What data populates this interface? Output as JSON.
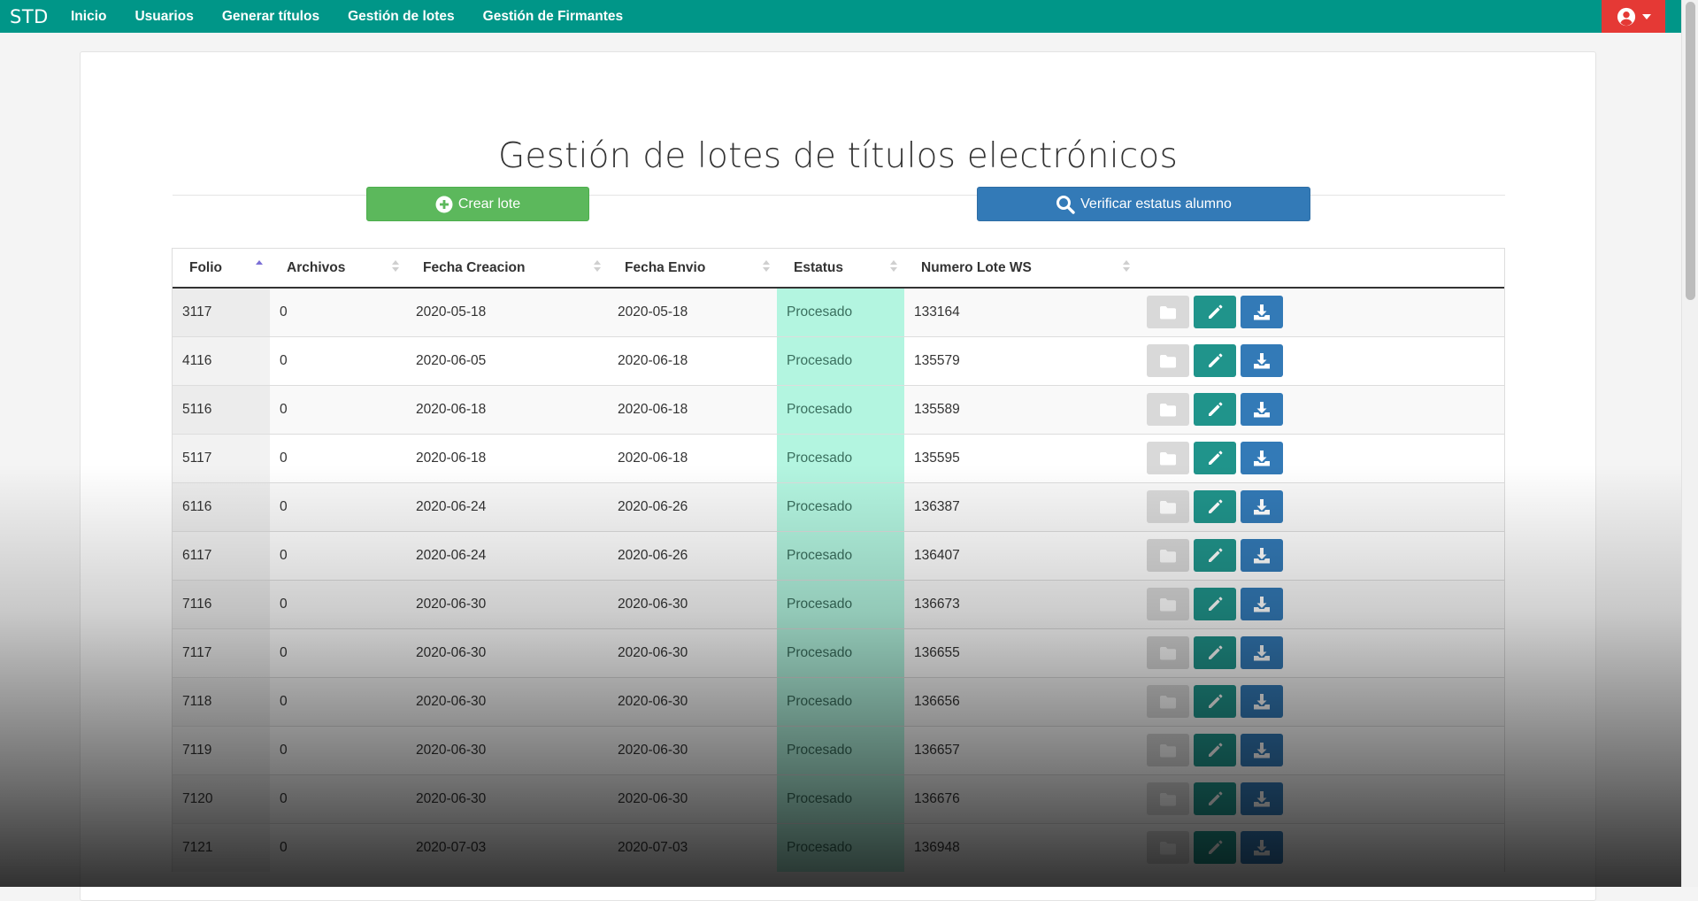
{
  "nav": {
    "brand": "STD",
    "items": [
      {
        "label": "Inicio"
      },
      {
        "label": "Usuarios"
      },
      {
        "label": "Generar títulos"
      },
      {
        "label": "Gestión de lotes"
      },
      {
        "label": "Gestión de Firmantes"
      }
    ],
    "user_icon": "user-circle-icon",
    "user_menu_color": "#e53935"
  },
  "page": {
    "title": "Gestión de lotes de títulos electrónicos",
    "create_button": "Crear lote",
    "verify_button": "Verificar estatus alumno"
  },
  "table": {
    "columns": [
      "Folio",
      "Archivos",
      "Fecha Creacion",
      "Fecha Envio",
      "Estatus",
      "Numero Lote WS"
    ],
    "sorted_column": "Folio",
    "sort_direction": "ascending",
    "rows": [
      {
        "folio": "3117",
        "archivos": "0",
        "fecha_creacion": "2020-05-18",
        "fecha_envio": "2020-05-18",
        "estatus": "Procesado",
        "numero_lote_ws": "133164"
      },
      {
        "folio": "4116",
        "archivos": "0",
        "fecha_creacion": "2020-06-05",
        "fecha_envio": "2020-06-18",
        "estatus": "Procesado",
        "numero_lote_ws": "135579"
      },
      {
        "folio": "5116",
        "archivos": "0",
        "fecha_creacion": "2020-06-18",
        "fecha_envio": "2020-06-18",
        "estatus": "Procesado",
        "numero_lote_ws": "135589"
      },
      {
        "folio": "5117",
        "archivos": "0",
        "fecha_creacion": "2020-06-18",
        "fecha_envio": "2020-06-18",
        "estatus": "Procesado",
        "numero_lote_ws": "135595"
      },
      {
        "folio": "6116",
        "archivos": "0",
        "fecha_creacion": "2020-06-24",
        "fecha_envio": "2020-06-26",
        "estatus": "Procesado",
        "numero_lote_ws": "136387"
      },
      {
        "folio": "6117",
        "archivos": "0",
        "fecha_creacion": "2020-06-24",
        "fecha_envio": "2020-06-26",
        "estatus": "Procesado",
        "numero_lote_ws": "136407"
      },
      {
        "folio": "7116",
        "archivos": "0",
        "fecha_creacion": "2020-06-30",
        "fecha_envio": "2020-06-30",
        "estatus": "Procesado",
        "numero_lote_ws": "136673"
      },
      {
        "folio": "7117",
        "archivos": "0",
        "fecha_creacion": "2020-06-30",
        "fecha_envio": "2020-06-30",
        "estatus": "Procesado",
        "numero_lote_ws": "136655"
      },
      {
        "folio": "7118",
        "archivos": "0",
        "fecha_creacion": "2020-06-30",
        "fecha_envio": "2020-06-30",
        "estatus": "Procesado",
        "numero_lote_ws": "136656"
      },
      {
        "folio": "7119",
        "archivos": "0",
        "fecha_creacion": "2020-06-30",
        "fecha_envio": "2020-06-30",
        "estatus": "Procesado",
        "numero_lote_ws": "136657"
      },
      {
        "folio": "7120",
        "archivos": "0",
        "fecha_creacion": "2020-06-30",
        "fecha_envio": "2020-06-30",
        "estatus": "Procesado",
        "numero_lote_ws": "136676"
      },
      {
        "folio": "7121",
        "archivos": "0",
        "fecha_creacion": "2020-07-03",
        "fecha_envio": "2020-07-03",
        "estatus": "Procesado",
        "numero_lote_ws": "136948"
      }
    ],
    "row_actions": [
      "folder-icon",
      "pencil-icon",
      "download-icon"
    ]
  },
  "colors": {
    "navbar": "#009688",
    "create_button": "#5cb85c",
    "verify_button": "#337ab7",
    "status_highlight": "#b3f5e0",
    "edit_action": "#20948b",
    "download_action": "#337ab7",
    "folder_action": "#d9d9d9"
  }
}
